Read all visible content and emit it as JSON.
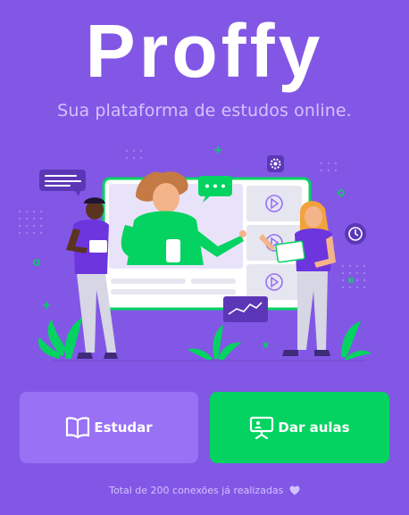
{
  "logo_text": "Proffy",
  "tagline": "Sua plataforma de estudos online.",
  "buttons": {
    "study_label": "Estudar",
    "study_icon": "book-icon",
    "give_classes_label": "Dar aulas",
    "give_classes_icon": "presentation-icon"
  },
  "footer": {
    "text": "Total de 200 conexões já realizadas",
    "icon": "heart-icon"
  },
  "colors": {
    "background": "#8257E5",
    "study_button": "#9871F5",
    "give_classes_button": "#04D361",
    "tagline": "#D4C2FF"
  }
}
